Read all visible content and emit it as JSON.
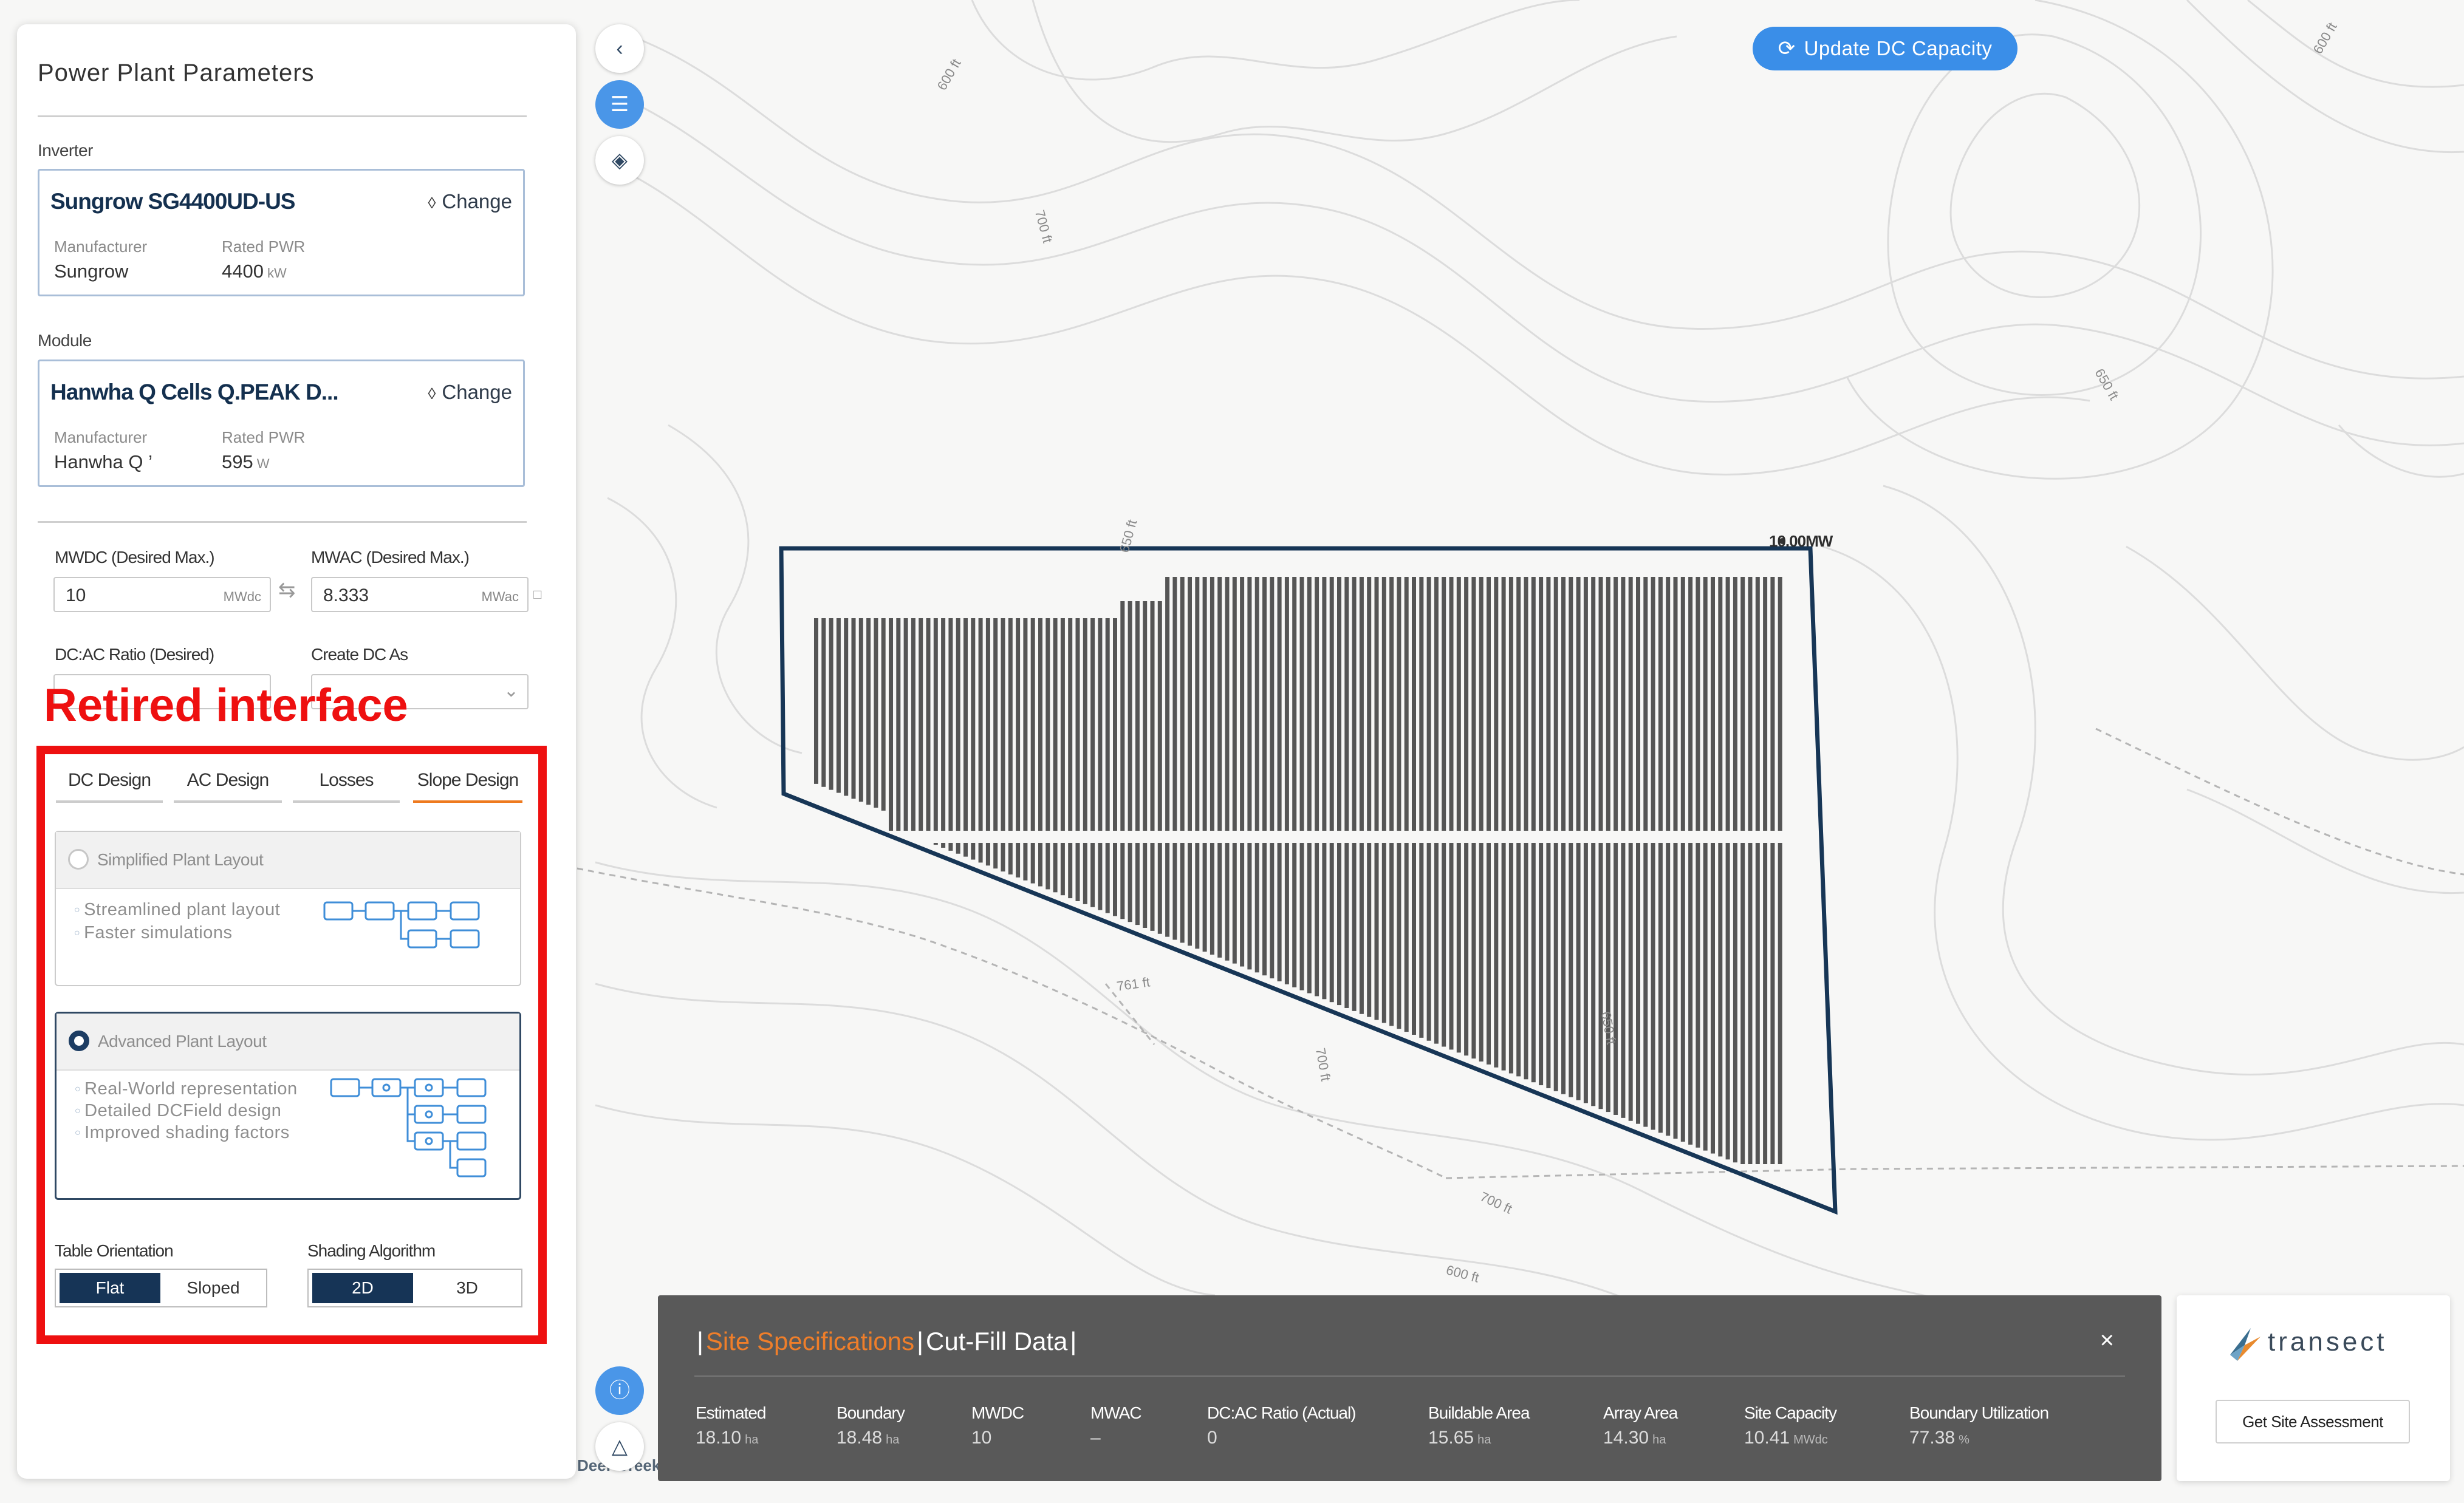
{
  "panel": {
    "title": "Power Plant Parameters",
    "inverter": {
      "section_label": "Inverter",
      "name": "Sungrow SG4400UD-US",
      "change_label": "Change",
      "manufacturer_label": "Manufacturer",
      "manufacturer": "Sungrow",
      "rated_label": "Rated PWR",
      "rated_value": "4400",
      "rated_unit": "kW"
    },
    "module": {
      "section_label": "Module",
      "name": "Hanwha Q Cells Q.PEAK D...",
      "change_label": "Change",
      "manufacturer_label": "Manufacturer",
      "manufacturer": "Hanwha Q ’",
      "rated_label": "Rated PWR",
      "rated_value": "595",
      "rated_unit": "W"
    },
    "mwdc": {
      "label": "MWDC (Desired Max.)",
      "value": "10",
      "unit": "MWdc"
    },
    "mwac": {
      "label": "MWAC (Desired Max.)",
      "value": "8.333",
      "unit": "MWac"
    },
    "dcac_label": "DC:AC Ratio (Desired)",
    "create_dc_label": "Create DC As",
    "annotation": "Retired interface",
    "tabs": [
      "DC Design",
      "AC Design",
      "Losses",
      "Slope Design"
    ],
    "active_tab": "Slope Design",
    "simplified": {
      "title": "Simplified Plant Layout",
      "bullets": [
        "Streamlined plant layout",
        "Faster simulations"
      ]
    },
    "advanced": {
      "title": "Advanced Plant Layout",
      "bullets": [
        "Real-World representation",
        "Detailed DCField design",
        "Improved shading factors"
      ]
    },
    "table_orientation": {
      "label": "Table Orientation",
      "options": [
        "Flat",
        "Sloped"
      ],
      "selected": "Flat"
    },
    "shading_algorithm": {
      "label": "Shading Algorithm",
      "options": [
        "2D",
        "3D"
      ],
      "selected": "2D"
    }
  },
  "map": {
    "update_button": "Update DC Capacity",
    "capacity_label": "10.00MW",
    "caption": "Deer Creek",
    "contour_labels": [
      "600 ft",
      "600 ft",
      "650 ft",
      "700 ft",
      "761 ft",
      "700 ft",
      "700 ft",
      "650 ft",
      "600 ft",
      "650 ft"
    ]
  },
  "specs": {
    "tab1": "Site Specifications",
    "tab2": "Cut-Fill Data",
    "metrics": [
      {
        "label": "Estimated",
        "value": "18.10",
        "unit": "ha"
      },
      {
        "label": "Boundary",
        "value": "18.48",
        "unit": "ha"
      },
      {
        "label": "MWDC",
        "value": "10",
        "unit": ""
      },
      {
        "label": "MWAC",
        "value": "–",
        "unit": ""
      },
      {
        "label": "DC:AC Ratio (Actual)",
        "value": "0",
        "unit": ""
      },
      {
        "label": "Buildable Area",
        "value": "15.65",
        "unit": "ha"
      },
      {
        "label": "Array Area",
        "value": "14.30",
        "unit": "ha"
      },
      {
        "label": "Site Capacity",
        "value": "10.41",
        "unit": "MWdc"
      },
      {
        "label": "Boundary Utilization",
        "value": "77.38",
        "unit": "%"
      }
    ]
  },
  "transect": {
    "name": "transect",
    "button": "Get Site Assessment"
  },
  "colors": {
    "brand_navy": "#163456",
    "accent_orange": "#ee7a1f",
    "accent_blue": "#3a8ee8",
    "annotation_red": "#ee1010"
  }
}
